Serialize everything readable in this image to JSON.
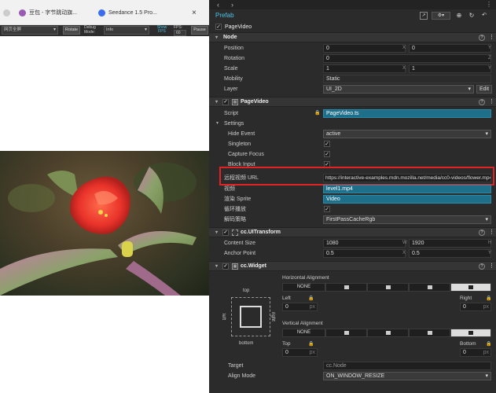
{
  "browser": {
    "tabs": [
      {
        "label": "豆包 - 字节跳动旗...",
        "color": "#9b59b6"
      },
      {
        "label": "Seedance 1.5 Pro...",
        "color": "#3a6cf0"
      }
    ],
    "close_label": "×"
  },
  "devbar": {
    "resolution": "网页全屏",
    "rotate": "Rotate",
    "debug_mode_label": "Debug Mode:",
    "debug_mode": "Info",
    "show_fps": "Show FPS",
    "fps_label": "FPS:",
    "fps": "60",
    "pause": "Pause"
  },
  "inspector": {
    "header_title": "Prefab",
    "node_name": "PageVideo",
    "node_section": {
      "title": "Node",
      "position_label": "Position",
      "position": {
        "x": "0",
        "y": "0",
        "z": "0"
      },
      "rotation_label": "Rotation",
      "rotation": {
        "z": "0"
      },
      "scale_label": "Scale",
      "scale": {
        "x": "1",
        "y": "1"
      },
      "mobility_label": "Mobility",
      "mobility": "Static",
      "layer_label": "Layer",
      "layer": "UI_2D",
      "edit": "Edit"
    },
    "pagevideo_section": {
      "title": "PageVideo",
      "script_label": "Script",
      "script": "PageVideo.ts",
      "settings_label": "Settings",
      "hide_event_label": "Hide Event",
      "hide_event": "active",
      "singleton_label": "Singleton",
      "capture_focus_label": "Capture Focus",
      "block_input_label": "Block Input",
      "remote_url_label": "远程视频 URL",
      "remote_url": "https://interactive-examples.mdn.mozilla.net/media/cc0-videos/flower.mp4",
      "video_label": "视频",
      "video": "level1.mp4",
      "render_sprite_label": "渲染 Sprite",
      "render_sprite": "Video",
      "loop_label": "循环播放",
      "decode_label": "解码策略",
      "decode": "FirstPassCacheRgb"
    },
    "uitransform_section": {
      "title": "cc.UITransform",
      "content_size_label": "Content Size",
      "width": "1080",
      "height": "1920",
      "anchor_label": "Anchor Point",
      "anchor_x": "0.5",
      "anchor_y": "0.5",
      "w": "W",
      "h": "H",
      "x": "X",
      "y": "Y"
    },
    "widget_section": {
      "title": "cc.Widget",
      "horizontal_alignment": "Horizontal Alignment",
      "vertical_alignment": "Vertical Alignment",
      "none": "NONE",
      "top": "top",
      "bottom": "bottom",
      "left": "left",
      "right": "right",
      "left_label": "Left",
      "left_value": "0",
      "right_label": "Right",
      "right_value": "0",
      "top_label": "Top",
      "top_value": "0",
      "bottom_label": "Bottom",
      "bottom_value": "0",
      "px": "px",
      "target_label": "Target",
      "target": "cc.Node",
      "align_mode_label": "Align Mode",
      "align_mode": "ON_WINDOW_RESIZE"
    }
  },
  "colors": {
    "highlight": "#e02424",
    "accent": "#1e6f8a",
    "prefab_title": "#4fc3e8"
  }
}
